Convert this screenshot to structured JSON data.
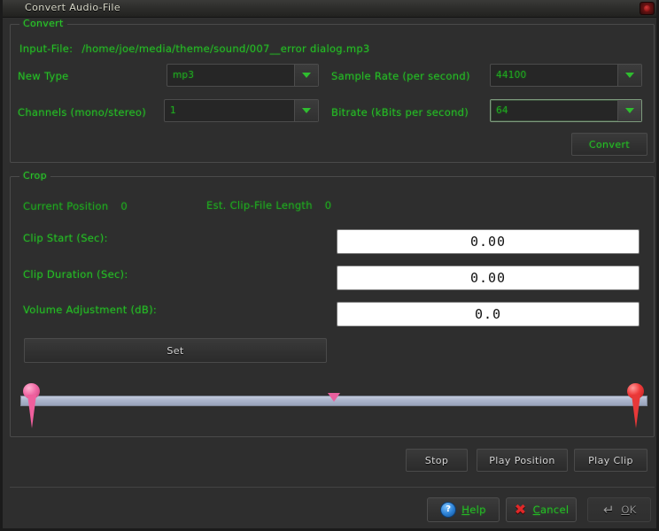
{
  "window": {
    "title": "Convert Audio-File",
    "close_icon": "close-icon"
  },
  "convert": {
    "legend": "Convert",
    "input_file_label": "Input-File:",
    "input_file_value": "/home/joe/media/theme/sound/007__error dialog.mp3",
    "fields": {
      "new_type_label": "New Type",
      "new_type_value": "mp3",
      "sample_rate_label": "Sample Rate (per second)",
      "sample_rate_value": "44100",
      "channels_label": "Channels (mono/stereo)",
      "channels_value": "1",
      "bitrate_label": "Bitrate (kBits per second)",
      "bitrate_value": "64"
    },
    "convert_button": "Convert"
  },
  "crop": {
    "legend": "Crop",
    "current_position_label": "Current Position",
    "current_position_value": "0",
    "est_clip_length_label": "Est. Clip-File Length",
    "est_clip_length_value": "0",
    "clip_start_label": "Clip Start (Sec):",
    "clip_start_value": "0.00",
    "clip_duration_label": "Clip Duration (Sec):",
    "clip_duration_value": "0.00",
    "volume_adjustment_label": "Volume Adjustment (dB):",
    "volume_adjustment_value": "0.0",
    "set_button": "Set",
    "timeline": {
      "start_marker": "clip-start-pin",
      "end_marker": "clip-end-pin",
      "position_marker": "playback-position-marker",
      "position_percent": 50
    },
    "transport": {
      "stop": "Stop",
      "play_position": "Play Position",
      "play_clip": "Play Clip"
    }
  },
  "footer": {
    "help": "Help",
    "help_icon": "question-circle-icon",
    "help_mnemonic": "H",
    "cancel": "Cancel",
    "cancel_icon": "x-icon",
    "cancel_mnemonic": "C",
    "ok": "OK",
    "ok_icon": "enter-arrow-icon",
    "ok_mnemonic": "O"
  },
  "colors": {
    "accent_green": "#25bd25",
    "window_bg": "#2e2e2e",
    "timeline": "#aab4cb",
    "pin_start": "#ef5f9d",
    "pin_end": "#e83838"
  }
}
